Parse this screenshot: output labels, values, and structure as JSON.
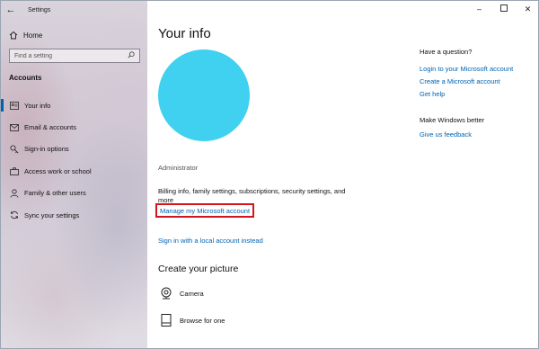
{
  "window": {
    "title": "Settings"
  },
  "sidebar": {
    "back_icon": "back-arrow-icon",
    "home_label": "Home",
    "search_placeholder": "Find a setting",
    "section_title": "Accounts",
    "items": [
      {
        "label": "Your info",
        "icon": "person-card-icon",
        "active": true
      },
      {
        "label": "Email & accounts",
        "icon": "mail-icon",
        "active": false
      },
      {
        "label": "Sign-in options",
        "icon": "key-icon",
        "active": false
      },
      {
        "label": "Access work or school",
        "icon": "briefcase-icon",
        "active": false
      },
      {
        "label": "Family & other users",
        "icon": "person-icon",
        "active": false
      },
      {
        "label": "Sync your settings",
        "icon": "sync-icon",
        "active": false
      }
    ]
  },
  "main": {
    "title": "Your info",
    "avatar_color": "#3fd1ef",
    "role": "Administrator",
    "billing_text": "Billing info, family settings, subscriptions, security settings, and more",
    "manage_link": "Manage my Microsoft account",
    "highlight_color": "#d4161c",
    "local_account_link": "Sign in with a local account instead",
    "create_picture_heading": "Create your picture",
    "picture_options": [
      {
        "label": "Camera",
        "icon": "camera-icon"
      },
      {
        "label": "Browse for one",
        "icon": "browse-file-icon"
      }
    ]
  },
  "right_column": {
    "question_heading": "Have a question?",
    "question_links": [
      "Login to your Microsoft account",
      "Create a Microsoft account",
      "Get help"
    ],
    "better_heading": "Make Windows better",
    "better_link": "Give us feedback"
  },
  "accent_color": "#0063b1"
}
